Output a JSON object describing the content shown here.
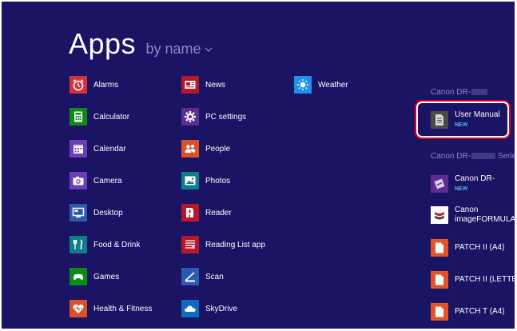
{
  "header": {
    "title": "Apps",
    "sort_label": "by name"
  },
  "columns": [
    [
      {
        "label": "Alarms",
        "color": "#d13438",
        "icon": "alarm-clock-icon"
      },
      {
        "label": "Calculator",
        "color": "#0e8a16",
        "icon": "calculator-icon"
      },
      {
        "label": "Calendar",
        "color": "#6b3fb6",
        "icon": "calendar-icon"
      },
      {
        "label": "Camera",
        "color": "#6b3fb6",
        "icon": "camera-icon"
      },
      {
        "label": "Desktop",
        "color": "#2d5ab1",
        "icon": "desktop-icon"
      },
      {
        "label": "Food & Drink",
        "color": "#0f7e8c",
        "icon": "fork-knife-icon"
      },
      {
        "label": "Games",
        "color": "#0e8a16",
        "icon": "game-controller-icon"
      },
      {
        "label": "Health & Fitness",
        "color": "#d9502c",
        "icon": "heart-pulse-icon"
      }
    ],
    [
      {
        "label": "News",
        "color": "#b5182b",
        "icon": "newspaper-icon"
      },
      {
        "label": "PC settings",
        "color": "#5c2d91",
        "icon": "gear-icon"
      },
      {
        "label": "People",
        "color": "#d9502c",
        "icon": "people-icon"
      },
      {
        "label": "Photos",
        "color": "#0f7e8c",
        "icon": "photo-icon"
      },
      {
        "label": "Reader",
        "color": "#b5182b",
        "icon": "reader-icon"
      },
      {
        "label": "Reading List app",
        "color": "#b5182b",
        "icon": "reading-list-icon"
      },
      {
        "label": "Scan",
        "color": "#2d5ab1",
        "icon": "scanner-icon"
      },
      {
        "label": "SkyDrive",
        "color": "#0f6cbd",
        "icon": "cloud-icon"
      }
    ],
    [
      {
        "label": "Weather",
        "color": "#1e90e8",
        "icon": "sun-icon"
      }
    ]
  ],
  "groups": [
    {
      "header": "Canon DR-"
    },
    {
      "header": "Canon DR-",
      "header_suffix": "Series"
    }
  ],
  "manual_tile": {
    "label": "User Manual",
    "badge": "NEW",
    "color": "#4a4a4a",
    "icon": "document-icon"
  },
  "canon_tiles": [
    {
      "line1": "Canon DR-",
      "line2": "NEW",
      "color": "#5c2d91",
      "icon": "scanner-app-icon"
    },
    {
      "line1": "Canon",
      "line2": "imageFORMULA",
      "color": "#ffffff",
      "icon": "imageformula-icon"
    },
    {
      "line1": "PATCH II (A4)",
      "color": "#e2552a",
      "icon": "pdf-document-icon"
    },
    {
      "line1": "PATCH II (LETTER)",
      "color": "#e2552a",
      "icon": "pdf-document-icon"
    },
    {
      "line1": "PATCH T (A4)",
      "color": "#e2552a",
      "icon": "pdf-document-icon"
    }
  ]
}
